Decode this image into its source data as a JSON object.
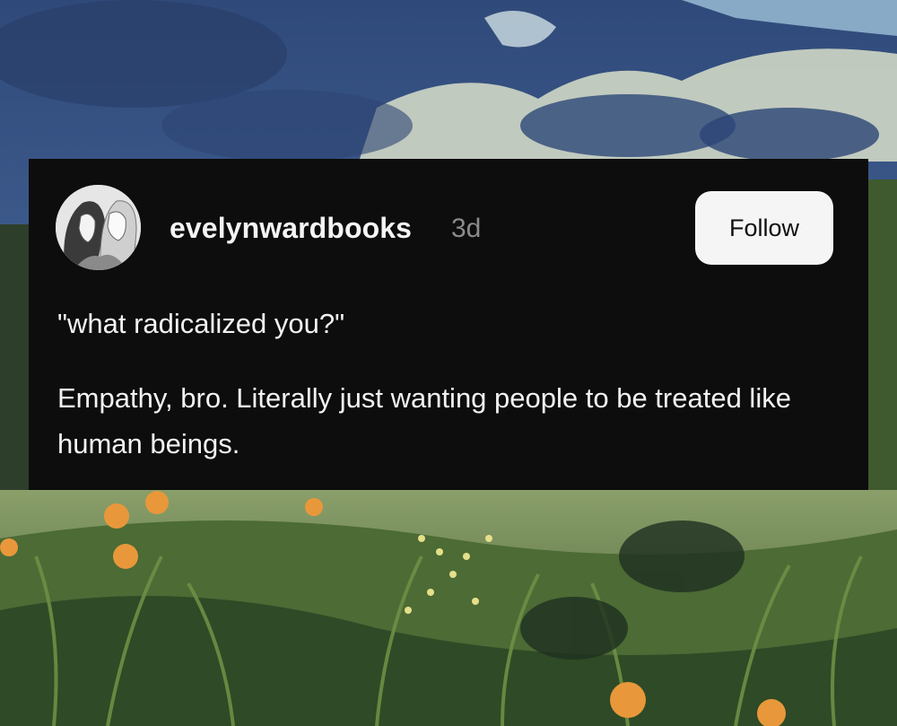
{
  "post": {
    "username": "evelynwardbooks",
    "timestamp": "3d",
    "follow_label": "Follow",
    "quote": "\"what radicalized you?\"",
    "body": "Empathy, bro. Literally just wanting people to be treated like human beings."
  },
  "icons": {
    "avatar": "avatar-two-women-illustration"
  },
  "colors": {
    "card_background": "#0d0d0d",
    "text": "#f2f2f2",
    "timestamp": "#8a8a8a",
    "follow_button": "#f5f5f5"
  }
}
